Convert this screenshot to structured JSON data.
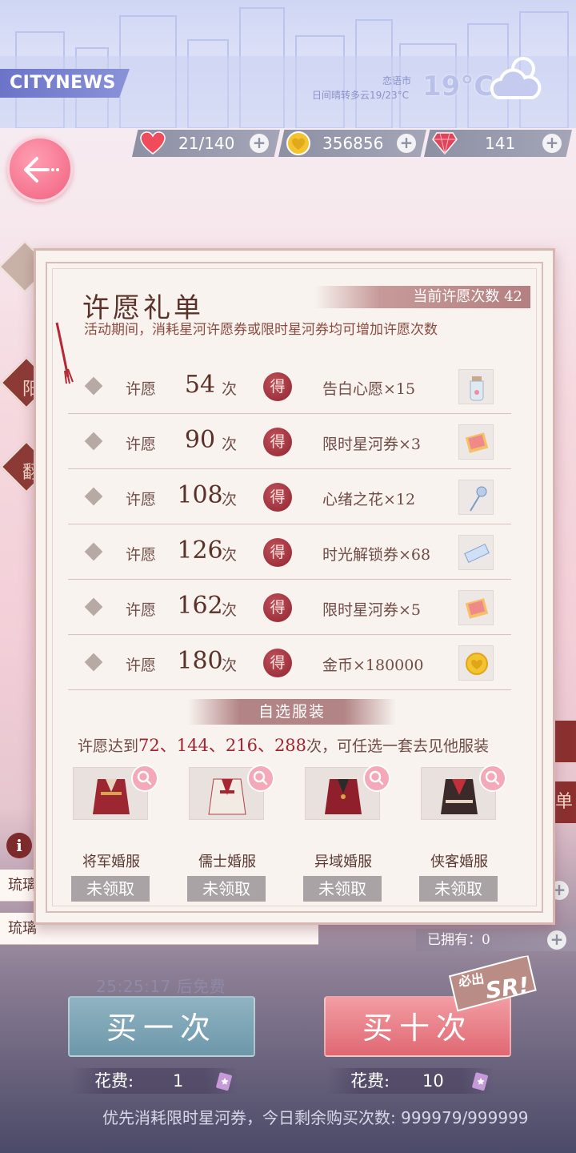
{
  "header": {
    "logo": "CITYNEWS",
    "city": "恋语市",
    "weather_desc": "日间晴转多云19/23°C",
    "temp": "19°C"
  },
  "resources": {
    "stamina": "21/140",
    "gold": "356856",
    "diamond": "141"
  },
  "modal": {
    "title": "许愿礼单",
    "count_label": "当前许愿次数 42",
    "description": "活动期间，消耗星河许愿券或限时星河券均可增加许愿次数",
    "rewards": [
      {
        "prefix": "许愿",
        "times": "54",
        "suffix": "次",
        "seal": "得",
        "item": "告白心愿×15",
        "icon": "bottle-icon"
      },
      {
        "prefix": "许愿",
        "times": "90",
        "suffix": "次",
        "seal": "得",
        "item": "限时星河券×3",
        "icon": "ticket-icon"
      },
      {
        "prefix": "许愿",
        "times": "108",
        "suffix": "次",
        "seal": "得",
        "item": "心绪之花×12",
        "icon": "flower-icon"
      },
      {
        "prefix": "许愿",
        "times": "126",
        "suffix": "次",
        "seal": "得",
        "item": "时光解锁券×68",
        "icon": "time-ticket-icon"
      },
      {
        "prefix": "许愿",
        "times": "162",
        "suffix": "次",
        "seal": "得",
        "item": "限时星河券×5",
        "icon": "ticket-icon"
      },
      {
        "prefix": "许愿",
        "times": "180",
        "suffix": "次",
        "seal": "得",
        "item": "金币×180000",
        "icon": "coin-icon"
      }
    ],
    "outfit_section": "自选服装",
    "milestone": {
      "prefix": "许愿达到",
      "m1": "72",
      "sep1": "、",
      "m2": "144",
      "sep2": "、",
      "m3": "216",
      "sep3": "、",
      "m4": "288",
      "suffix": "次，可任选一套去见他服装"
    },
    "outfits": [
      {
        "name": "将军婚服",
        "status": "未领取"
      },
      {
        "name": "儒士婚服",
        "status": "未领取"
      },
      {
        "name": "异域婚服",
        "status": "未领取"
      },
      {
        "name": "侠客婚服",
        "status": "未领取"
      }
    ]
  },
  "background": {
    "list_row1": "琉璃",
    "list_row2": "琉璃",
    "owned": "已拥有：0",
    "right_tab": "单",
    "left_tab_text1": "阳",
    "left_tab_text2": "翻"
  },
  "purchase": {
    "timer": "25:25:17 后免费",
    "buy_one": "买一次",
    "buy_ten": "买十次",
    "sr_badge_top": "必出",
    "sr_badge_main": "SR!",
    "cost_label": "花费:",
    "cost_one": "1",
    "cost_ten": "10",
    "note": "优先消耗限时星河券，今日剩余购买次数: 999979/999999"
  },
  "colors": {
    "accent_red": "#a3232f",
    "buy_one": "#7ea6b7",
    "buy_ten": "#e9808a"
  }
}
